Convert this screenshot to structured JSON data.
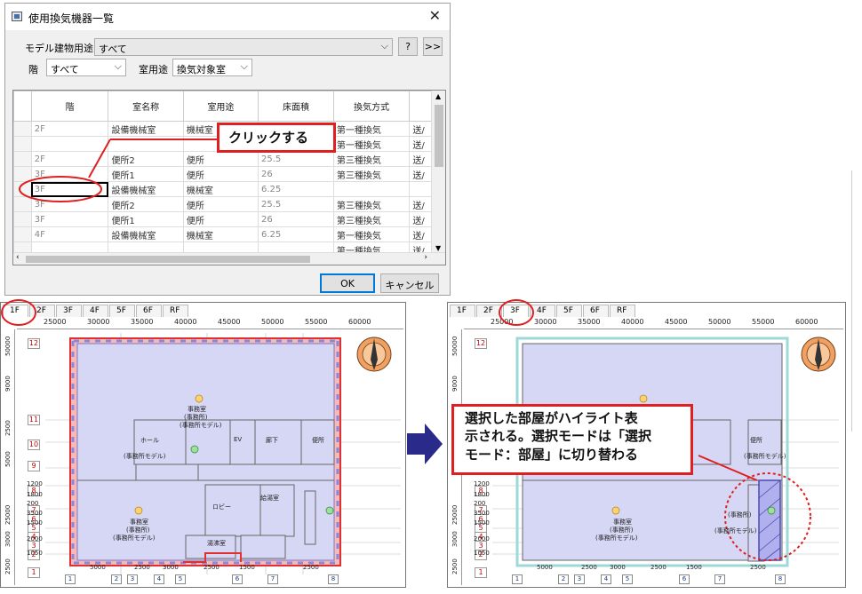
{
  "dialog": {
    "title": "使用換気機器一覧",
    "building_use_label": "モデル建物用途",
    "building_use_value": "すべて",
    "help_btn": "?",
    "expand_btn": ">>",
    "floor_label": "階",
    "floor_value": "すべて",
    "room_use_label": "室用途",
    "room_use_value": "換気対象室",
    "columns": [
      "階",
      "室名称",
      "室用途",
      "床面積",
      "換気方式",
      ""
    ],
    "rows": [
      [
        "2F",
        "設備機械室",
        "機械室",
        "6.25",
        "第一種換気",
        "送/"
      ],
      [
        "",
        "",
        "",
        "",
        "第一種換気",
        "送/"
      ],
      [
        "2F",
        "便所2",
        "便所",
        "25.5",
        "第三種換気",
        "送/"
      ],
      [
        "3F",
        "便所1",
        "便所",
        "26",
        "第三種換気",
        "送/"
      ],
      [
        "3F",
        "設備機械室",
        "機械室",
        "6.25",
        "",
        ""
      ],
      [
        "3F",
        "便所2",
        "便所",
        "25.5",
        "第三種換気",
        "送/"
      ],
      [
        "3F",
        "便所1",
        "便所",
        "26",
        "第三種換気",
        "送/"
      ],
      [
        "4F",
        "設備機械室",
        "機械室",
        "6.25",
        "第一種換気",
        "送/"
      ],
      [
        "",
        "",
        "",
        "",
        "第一種換気",
        "送/"
      ]
    ],
    "ok": "OK",
    "cancel": "キャンセル"
  },
  "callouts": {
    "click": "クリックする",
    "highlight_line1": "選択した部屋がハイライト表",
    "highlight_line2": "示される。選択モードは「選択",
    "highlight_line3": "モード：部屋」に切り替わる"
  },
  "plan_tabs": [
    "1F",
    "2F",
    "3F",
    "4F",
    "5F",
    "6F",
    "RF"
  ],
  "left_plan": {
    "active_tab": "1F"
  },
  "right_plan": {
    "active_tab": "3F"
  },
  "ruler_top": [
    "25000",
    "30000",
    "35000",
    "40000",
    "45000",
    "50000",
    "55000",
    "60000"
  ],
  "ruler_left": [
    "50000",
    "9000",
    "2500",
    "5000",
    "25000",
    "3000",
    "2500"
  ],
  "grid_markers": [
    "12",
    "11",
    "10",
    "9",
    "8",
    "7",
    "6",
    "5",
    "4",
    "3",
    "2",
    "1"
  ],
  "grid_values_left": [
    "1200",
    "1800",
    "200",
    "3500",
    "1500",
    "2000",
    "1050"
  ],
  "bottom_dims": [
    "5000",
    "2500",
    "3000",
    "2500",
    "1500",
    "2500"
  ],
  "bottom_markers": [
    "1",
    "2",
    "3",
    "4",
    "5",
    "6",
    "7",
    "8"
  ],
  "room_labels": {
    "office": "事務室",
    "office_sub": "(事務所)",
    "office_model": "(事務所モデル)",
    "lobby": "ロビー",
    "ev": "EV",
    "corridor": "廊下",
    "hall": "ホール",
    "wc": "便所",
    "kyuto": "給湯室",
    "pantry": "湯沸室"
  },
  "colors": {
    "room_fill": "#d6d6f5",
    "highlight": "#e03030",
    "accent": "#0078d7",
    "arrow": "#2a2a8a"
  }
}
